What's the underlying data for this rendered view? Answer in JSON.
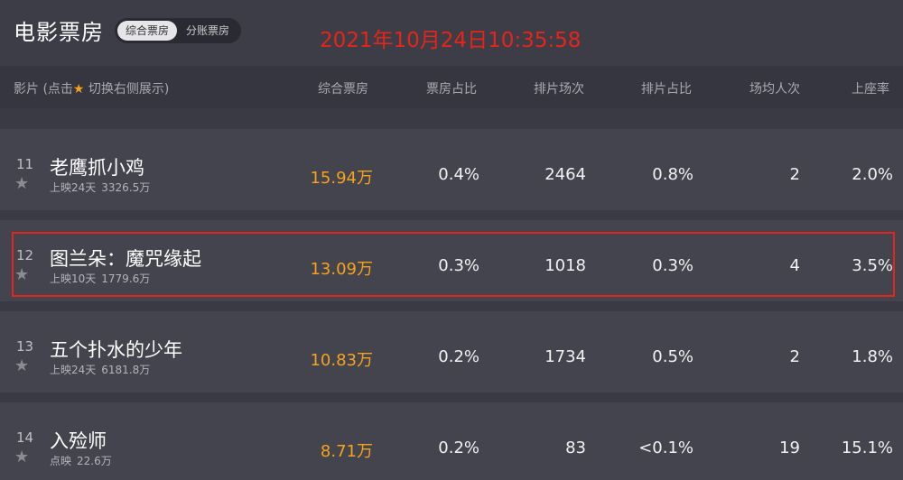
{
  "app": {
    "title": "电影票房",
    "toggle": {
      "active": "综合票房",
      "inactive": "分账票房"
    },
    "timestamp": "2021年10月24日10:35:58"
  },
  "table": {
    "headers": {
      "film_prefix": "影片 (点击",
      "film_star": "★",
      "film_suffix": " 切换右侧展示)",
      "box_office": "综合票房",
      "box_share": "票房占比",
      "screenings": "排片场次",
      "screening_share": "排片占比",
      "avg_attendance": "场均人次",
      "occupancy": "上座率"
    },
    "rows": [
      {
        "rank": "11",
        "title": "老鹰抓小鸡",
        "days": "上映24天",
        "total": "3326.5万",
        "box_office": "15.94万",
        "box_share": "0.4%",
        "screenings": "2464",
        "screening_share": "0.8%",
        "avg_attendance": "2",
        "occupancy": "2.0%"
      },
      {
        "rank": "12",
        "title": "图兰朵：魔咒缘起",
        "days": "上映10天",
        "total": "1779.6万",
        "box_office": "13.09万",
        "box_share": "0.3%",
        "screenings": "1018",
        "screening_share": "0.3%",
        "avg_attendance": "4",
        "occupancy": "3.5%"
      },
      {
        "rank": "13",
        "title": "五个扑水的少年",
        "days": "上映24天",
        "total": "6181.8万",
        "box_office": "10.83万",
        "box_share": "0.2%",
        "screenings": "1734",
        "screening_share": "0.5%",
        "avg_attendance": "2",
        "occupancy": "1.8%"
      },
      {
        "rank": "14",
        "title": "入殓师",
        "days": "点映",
        "total": "22.6万",
        "box_office": "8.71万",
        "box_share": "0.2%",
        "screenings": "83",
        "screening_share": "<0.1%",
        "avg_attendance": "19",
        "occupancy": "15.1%"
      }
    ]
  },
  "colors": {
    "accent": "#f7a21b",
    "highlight_border": "#e8231a",
    "background": "#3a3a44"
  }
}
